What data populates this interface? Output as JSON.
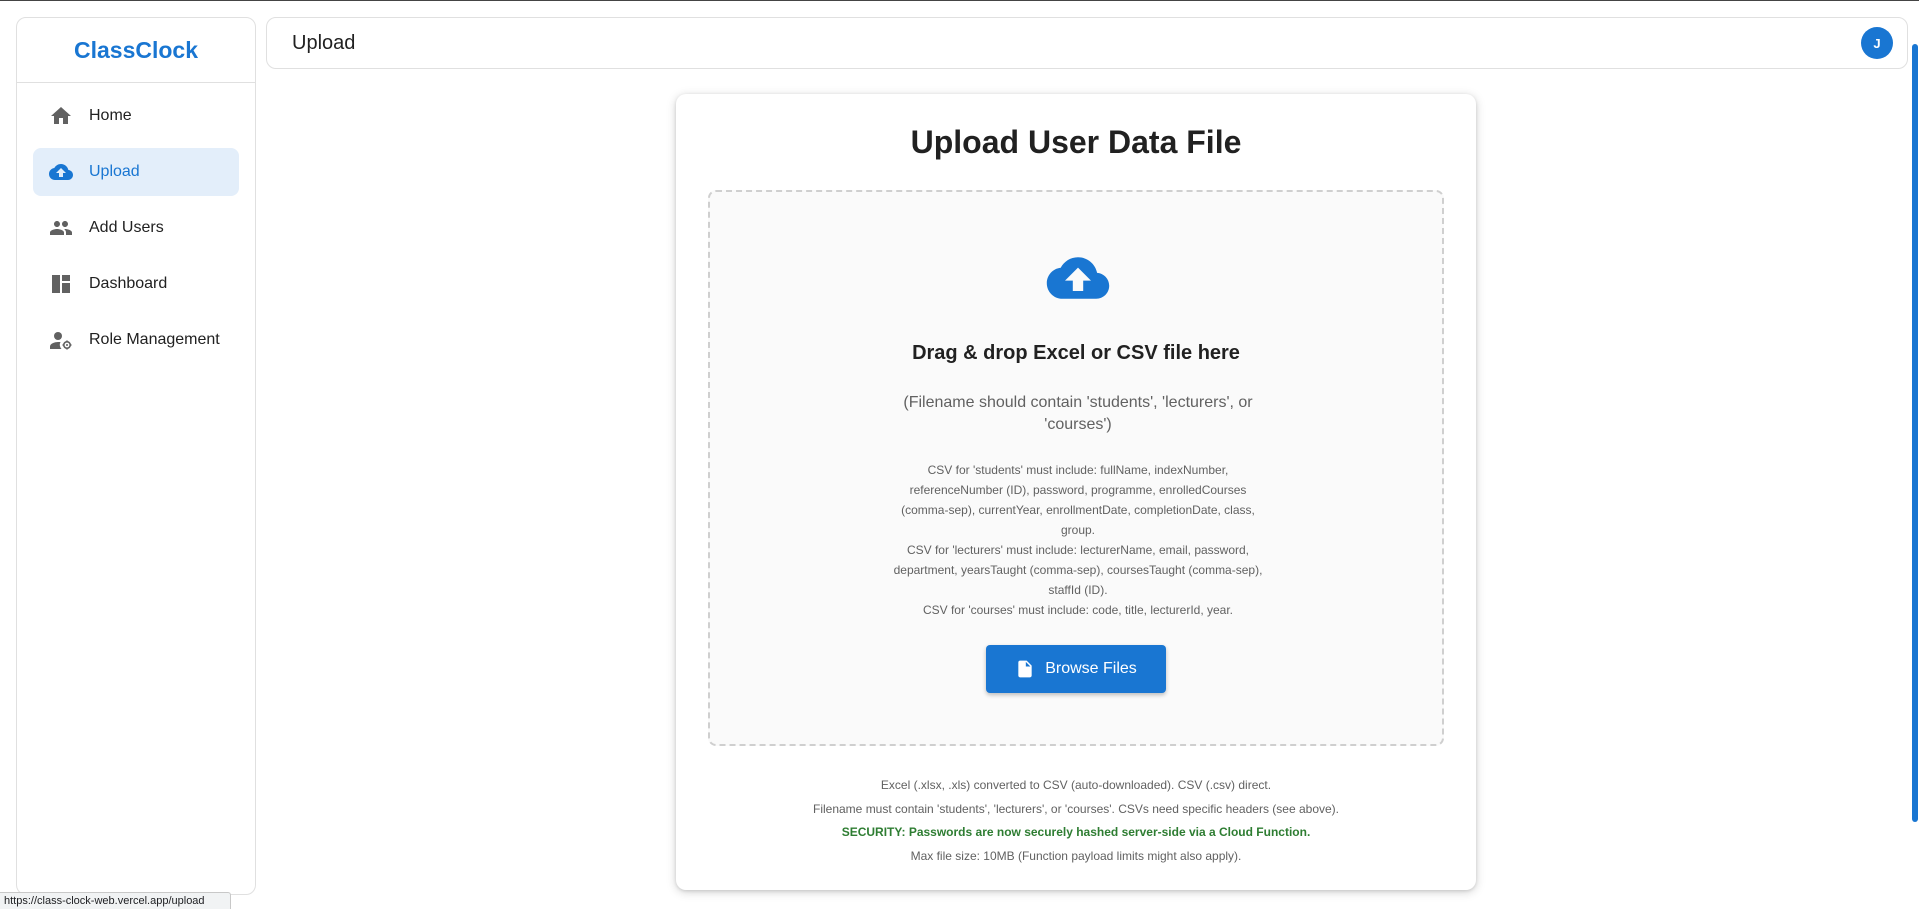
{
  "app": {
    "name": "ClassClock"
  },
  "sidebar": {
    "items": [
      {
        "label": "Home",
        "icon": "home-icon"
      },
      {
        "label": "Upload",
        "icon": "cloud-upload-icon",
        "active": true
      },
      {
        "label": "Add Users",
        "icon": "people-icon"
      },
      {
        "label": "Dashboard",
        "icon": "dashboard-icon"
      },
      {
        "label": "Role Management",
        "icon": "manage-accounts-icon"
      }
    ]
  },
  "header": {
    "title": "Upload",
    "avatar_initial": "J"
  },
  "upload_card": {
    "title": "Upload User Data File",
    "dropzone": {
      "title": "Drag & drop Excel or CSV file here",
      "subtitle": "(Filename should contain 'students', 'lecturers', or 'courses')",
      "help_students": "CSV for 'students' must include: fullName, indexNumber, referenceNumber (ID), password, programme, enrolledCourses (comma-sep), currentYear, enrollmentDate, completionDate, class, group.",
      "help_lecturers": "CSV for 'lecturers' must include: lecturerName, email, password, department, yearsTaught (comma-sep), coursesTaught (comma-sep), staffId (ID).",
      "help_courses": "CSV for 'courses' must include: code, title, lecturerId, year."
    },
    "browse_label": "Browse Files",
    "notes": {
      "conversion": "Excel (.xlsx, .xls) converted to CSV (auto-downloaded). CSV (.csv) direct.",
      "filename": "Filename must contain 'students', 'lecturers', or 'courses'. CSVs need specific headers (see above).",
      "security": "SECURITY: Passwords are now securely hashed server-side via a Cloud Function.",
      "max_size": "Max file size: 10MB (Function payload limits might also apply)."
    }
  },
  "status_bar": {
    "url": "https://class-clock-web.vercel.app/upload"
  },
  "colors": {
    "primary": "#1976d2",
    "active_bg": "#e3eefa",
    "security_text": "#2e7d32",
    "muted_text": "#616161"
  }
}
